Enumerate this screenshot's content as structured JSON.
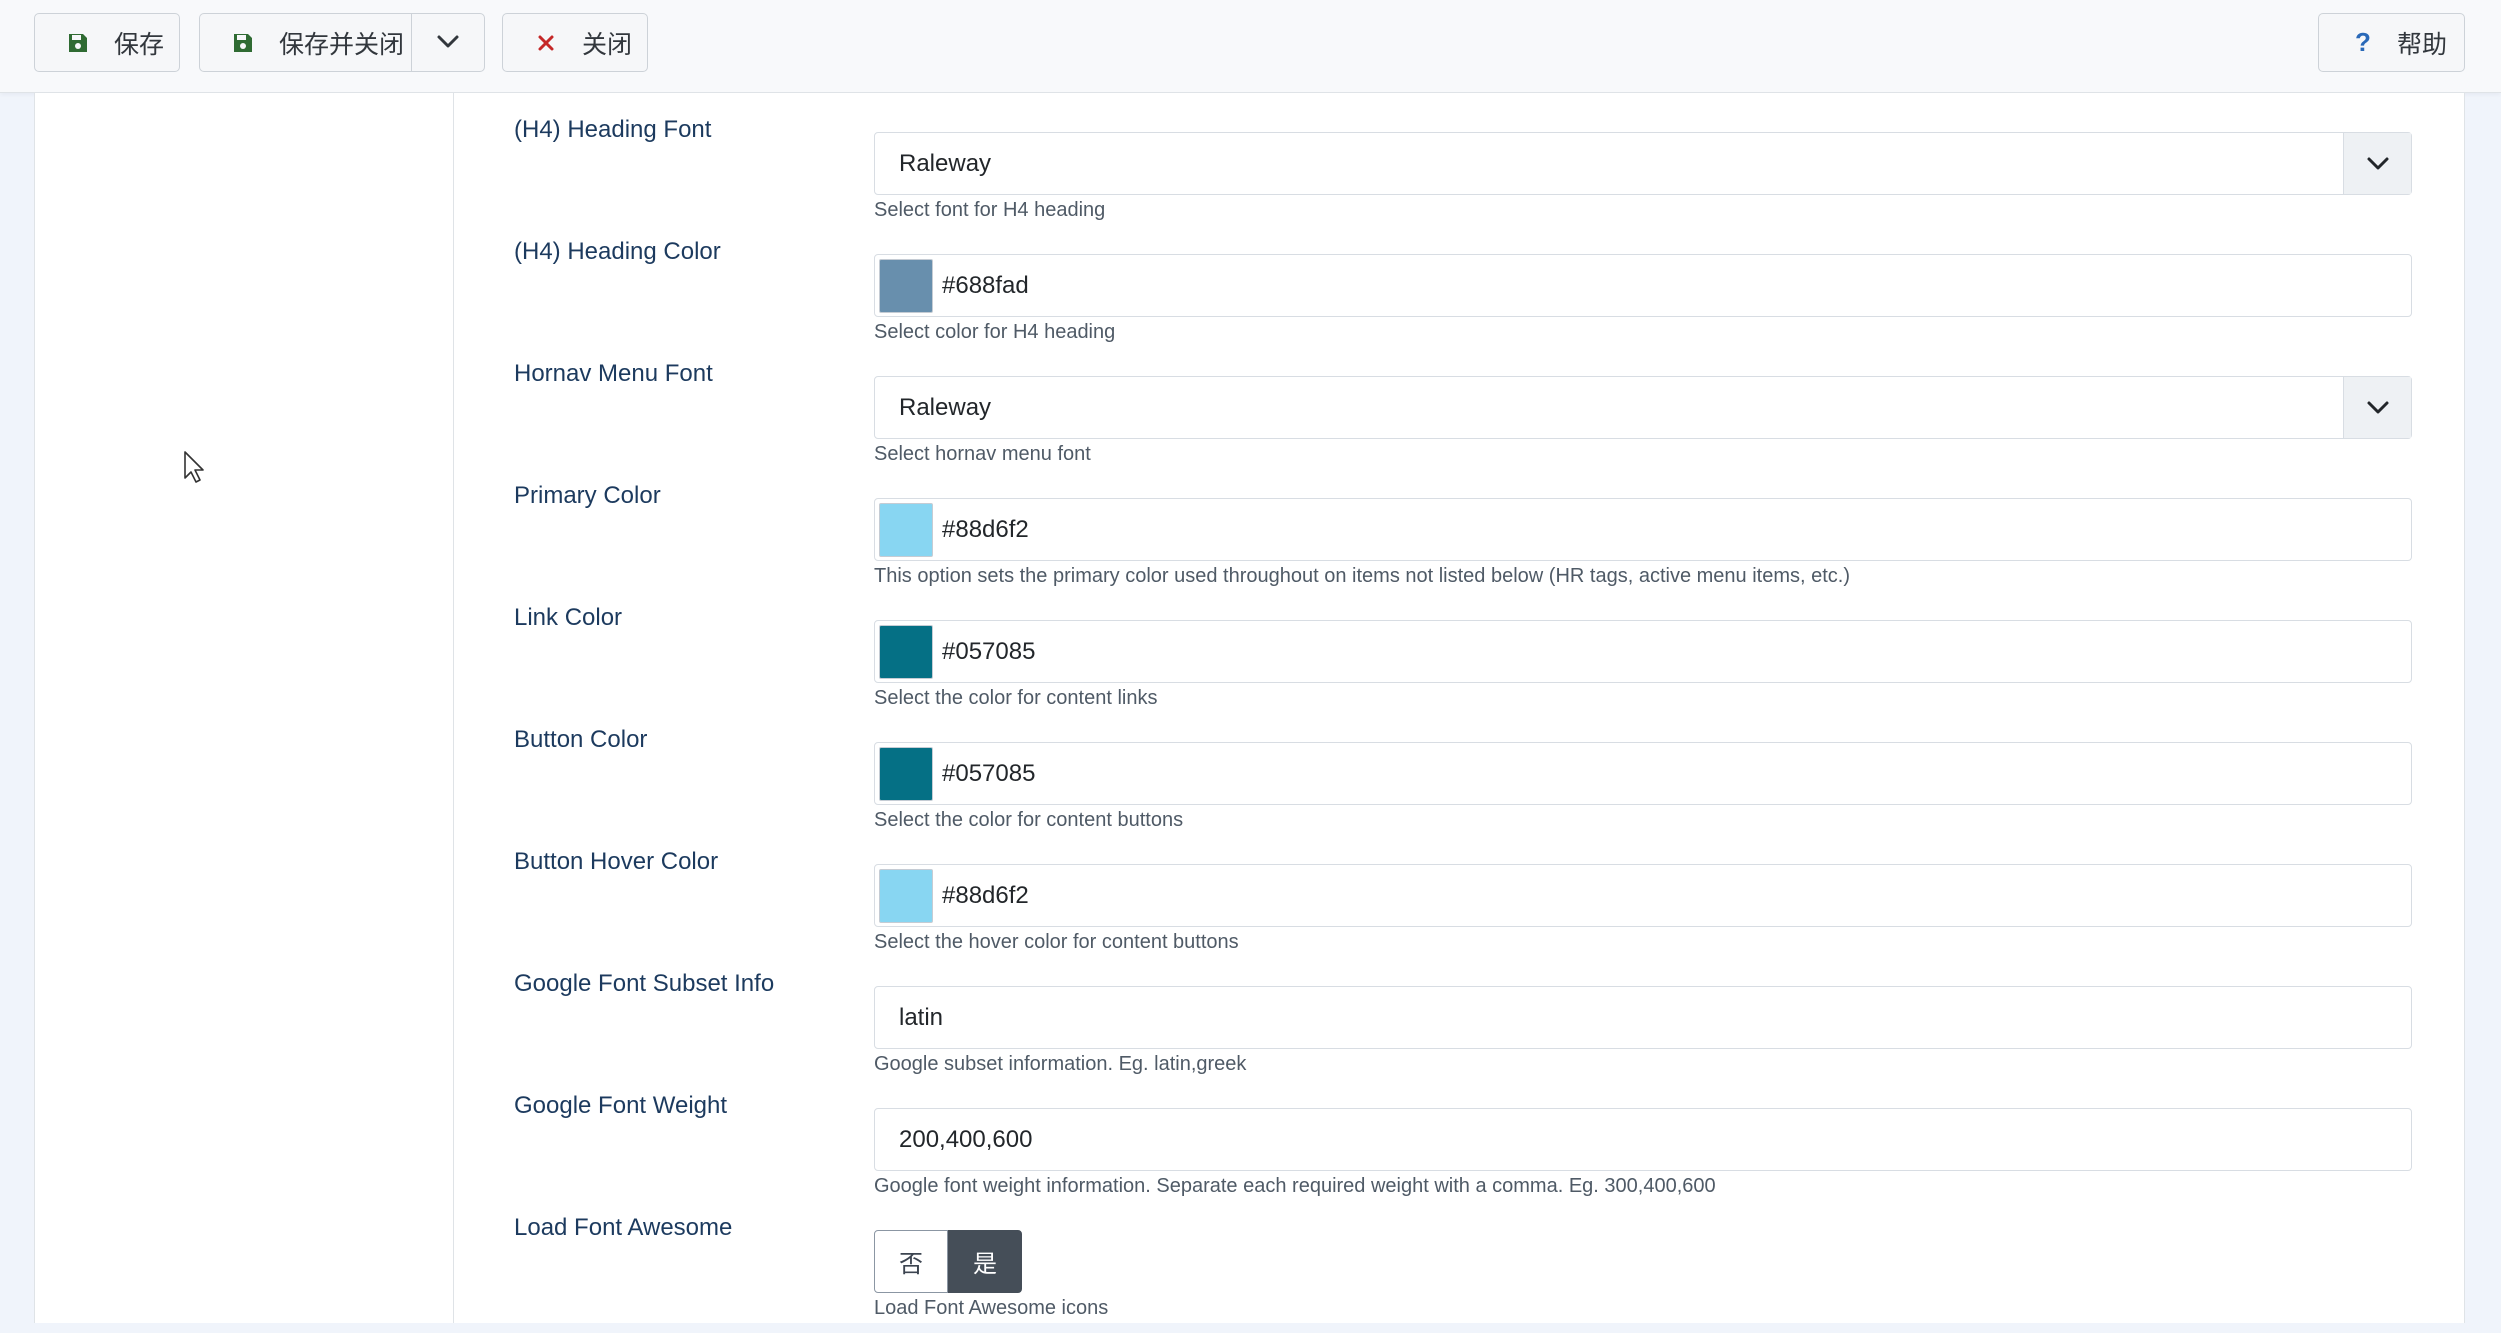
{
  "toolbar": {
    "save_label": "保存",
    "save_close_label": "保存并关闭",
    "close_label": "关闭",
    "help_label": "帮助"
  },
  "colors": {
    "save_icon": "#2f6b33",
    "close_icon": "#c52828",
    "help_icon": "#2a69b8",
    "label_text": "#1c3a5e",
    "toggle_active": "#454e58"
  },
  "icons": {
    "save": "floppy-disk-icon",
    "save_close": "floppy-disk-icon",
    "dropdown": "chevron-down-icon",
    "close": "x-icon",
    "help": "question-mark-icon",
    "select_caret": "chevron-down-icon",
    "cursor": "mouse-pointer-icon"
  },
  "form": {
    "fields": [
      {
        "label": "(H4) Heading Font",
        "type": "select",
        "value": "Raleway",
        "description": "Select font for H4 heading"
      },
      {
        "label": "(H4) Heading Color",
        "type": "color",
        "value": "#688fad",
        "swatch": "#688fad",
        "description": "Select color for H4 heading"
      },
      {
        "label": "Hornav Menu Font",
        "type": "select",
        "value": "Raleway",
        "description": "Select hornav menu font"
      },
      {
        "label": "Primary Color",
        "type": "color",
        "value": "#88d6f2",
        "swatch": "#88d6f2",
        "description": "This option sets the primary color used throughout on items not listed below (HR tags, active menu items, etc.)"
      },
      {
        "label": "Link Color",
        "type": "color",
        "value": "#057085",
        "swatch": "#057085",
        "description": "Select the color for content links"
      },
      {
        "label": "Button Color",
        "type": "color",
        "value": "#057085",
        "swatch": "#057085",
        "description": "Select the color for content buttons"
      },
      {
        "label": "Button Hover Color",
        "type": "color",
        "value": "#88d6f2",
        "swatch": "#88d6f2",
        "description": "Select the hover color for content buttons"
      },
      {
        "label": "Google Font Subset Info",
        "type": "text",
        "value": "latin",
        "description": "Google subset information. Eg. latin,greek"
      },
      {
        "label": "Google Font Weight",
        "type": "text",
        "value": "200,400,600",
        "description": "Google font weight information. Separate each required weight with a comma. Eg. 300,400,600"
      },
      {
        "label": "Load Font Awesome",
        "type": "toggle",
        "options": [
          "否",
          "是"
        ],
        "selected": "是",
        "description": "Load Font Awesome icons"
      }
    ]
  }
}
